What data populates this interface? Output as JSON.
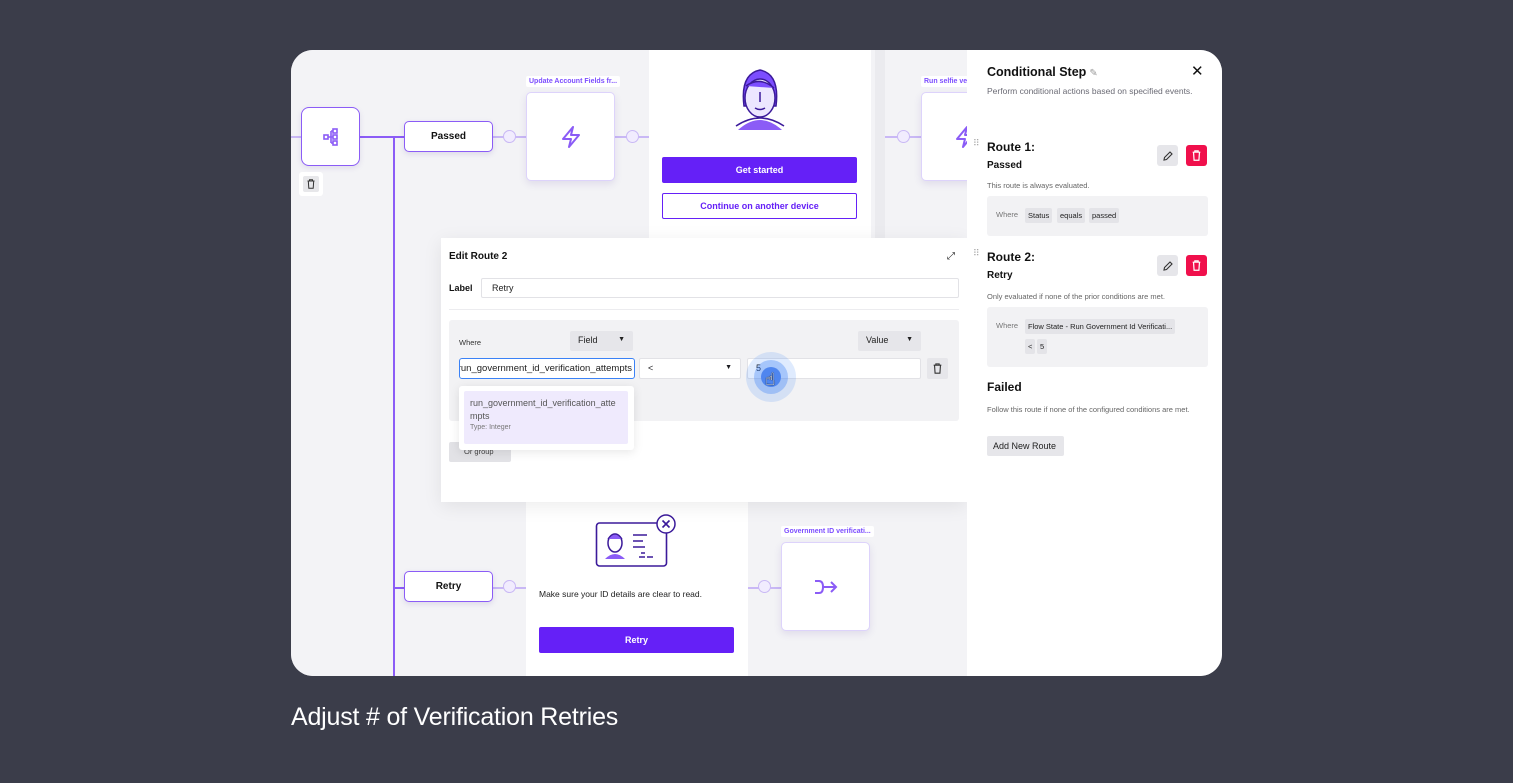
{
  "caption": "Adjust # of Verification Retries",
  "colors": {
    "accent": "#6520f7",
    "node_border": "#8b5cf6",
    "danger": "#f0104c",
    "page_bg": "#3b3d4a",
    "canvas_bg": "#f3f3f6"
  },
  "canvas": {
    "condition_node": {
      "icon": "branch-icon",
      "delete_icon": "trash-icon"
    },
    "routes": [
      {
        "label": "Passed"
      },
      {
        "label": "Retry"
      }
    ],
    "steps": {
      "update_account": {
        "label": "Update Account Fields fr...",
        "icon": "lightning-icon"
      },
      "run_selfie": {
        "label": "Run selfie ver",
        "icon": "lightning-icon"
      },
      "government_id": {
        "label": "Government ID verificati...",
        "icon": "merge-arrow-icon"
      }
    },
    "selfie_screen": {
      "illustration": "selfie-face-icon",
      "primary_button": "Get started",
      "secondary_button": "Continue on another device"
    },
    "retry_screen": {
      "illustration": "id-card-error-icon",
      "message": "Make sure your ID details are clear to read.",
      "button": "Retry"
    }
  },
  "edit_route": {
    "title": "Edit Route 2",
    "expand_icon": "expand-icon",
    "label_field_label": "Label",
    "label_value": "Retry",
    "where_label": "Where",
    "field_dropdown": "Field",
    "value_dropdown": "Value",
    "field_input_value": "run_government_id_verification_attempts",
    "operator": "<",
    "value": "5",
    "or_group_label": "Or group",
    "suggestion": {
      "name": "run_government_id_verification_attempts",
      "type": "Type: Integer"
    }
  },
  "side_panel": {
    "title": "Conditional Step",
    "description": "Perform conditional actions based on specified events.",
    "routes": [
      {
        "heading": "Route 1:",
        "name": "Passed",
        "note": "This route is always evaluated.",
        "where": "Where",
        "chips": [
          "Status",
          "equals",
          "passed"
        ]
      },
      {
        "heading": "Route 2:",
        "name": "Retry",
        "note": "Only evaluated if none of the prior conditions are met.",
        "where": "Where",
        "chips": [
          "Flow State - Run Government Id Verificati...",
          "<",
          "5"
        ]
      }
    ],
    "failed": {
      "heading": "Failed",
      "note": "Follow this route if none of the configured conditions are met."
    },
    "add_route_label": "Add New Route"
  }
}
